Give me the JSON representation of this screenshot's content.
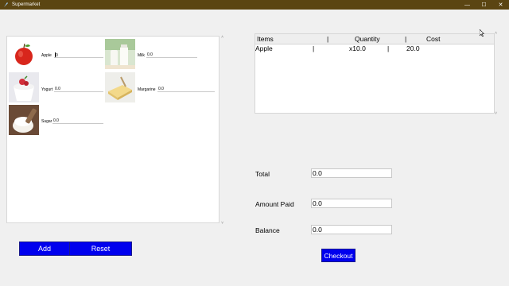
{
  "window": {
    "title": "Supermarket",
    "controls": {
      "minimize": "—",
      "maximize": "☐",
      "close": "✕"
    }
  },
  "products": [
    {
      "name": "Apple",
      "qty": "0",
      "icon": "apple-icon"
    },
    {
      "name": "Milk",
      "qty": "0.0",
      "icon": "milk-icon"
    },
    {
      "name": "Yogurt",
      "qty": "0.0",
      "icon": "yogurt-icon"
    },
    {
      "name": "Margarine",
      "qty": "0.0",
      "icon": "margarine-icon"
    },
    {
      "name": "Sugar",
      "qty": "0.0",
      "icon": "sugar-icon"
    }
  ],
  "buttons": {
    "add": "Add",
    "reset": "Reset",
    "checkout": "Checkout"
  },
  "cart": {
    "columns": [
      "Items",
      "Quantity",
      "Cost"
    ],
    "separator": "|",
    "rows": [
      {
        "item": "Apple",
        "quantity": "x10.0",
        "cost": "20.0"
      }
    ]
  },
  "summary": {
    "total_label": "Total",
    "total_value": "0.0",
    "paid_label": "Amount Paid",
    "paid_value": "0.0",
    "balance_label": "Balance",
    "balance_value": "0.0"
  },
  "colors": {
    "titlebar": "#5b4512",
    "button_blue": "#0000ee",
    "background": "#f0f0f0"
  }
}
